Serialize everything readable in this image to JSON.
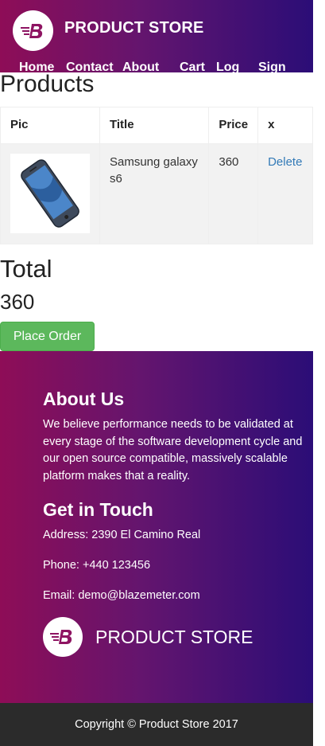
{
  "navbar": {
    "brand": "PRODUCT STORE",
    "links": [
      "Home",
      "Contact",
      "About",
      "Cart",
      "Log",
      "Sign"
    ]
  },
  "main": {
    "products_title": "Products",
    "table": {
      "columns": [
        "Pic",
        "Title",
        "Price",
        "x"
      ],
      "rows": [
        {
          "title": "Samsung galaxy s6",
          "price": "360",
          "action": "Delete"
        }
      ]
    },
    "total_title": "Total",
    "total_value": "360",
    "place_order_label": "Place Order"
  },
  "footer": {
    "about_title": "About Us",
    "about_text": "We believe performance needs to be validated at every stage of the software development cycle and our open source compatible, massively scalable platform makes that a reality.",
    "contact_title": "Get in Touch",
    "address": "Address: 2390 El Camino Real",
    "phone": "Phone: +440 123456",
    "email": "Email: demo@blazemeter.com",
    "brand": "PRODUCT STORE",
    "copyright": "Copyright © Product Store 2017"
  },
  "colors": {
    "gradient_start": "#8e0d57",
    "gradient_end": "#2b0d77",
    "place_order_button": "#5cb85c",
    "link": "#337ab7",
    "copyright_bar": "#2b2b2b"
  },
  "icons": {
    "brand_logo": "blazemeter-logo-icon",
    "product_image": "smartphone-icon"
  }
}
